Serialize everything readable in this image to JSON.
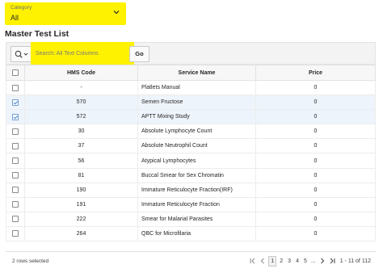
{
  "category": {
    "label": "Category",
    "value": "All"
  },
  "title": "Master Test List",
  "search": {
    "placeholder": "Search: All Text Columns",
    "go_label": "Go"
  },
  "table": {
    "columns": [
      "HMS Code",
      "Service Name",
      "Price"
    ],
    "rows": [
      {
        "hms": "-",
        "service": "Platlets Manual",
        "price": "0",
        "selected": false
      },
      {
        "hms": "570",
        "service": "Semen Fructose",
        "price": "0",
        "selected": true
      },
      {
        "hms": "572",
        "service": "APTT Mixing Study",
        "price": "0",
        "selected": true
      },
      {
        "hms": "30",
        "service": "Absolute Lymphocyte Count",
        "price": "0",
        "selected": false
      },
      {
        "hms": "37",
        "service": "Absolute Neutrophil Count",
        "price": "0",
        "selected": false
      },
      {
        "hms": "56",
        "service": "Atypical Lymphocytes",
        "price": "0",
        "selected": false
      },
      {
        "hms": "81",
        "service": "Buccal Smear for Sex Chromatin",
        "price": "0",
        "selected": false
      },
      {
        "hms": "190",
        "service": "Immature Reticulocyte Fraction(IRF)",
        "price": "0",
        "selected": false
      },
      {
        "hms": "191",
        "service": "Immature Reticulocyte Fraction",
        "price": "0",
        "selected": false
      },
      {
        "hms": "222",
        "service": "Smear for Malarial Parasites",
        "price": "0",
        "selected": false
      },
      {
        "hms": "264",
        "service": "QBC for Microfilaria",
        "price": "0",
        "selected": false
      }
    ]
  },
  "footer": {
    "rows_selected": "2 rows selected",
    "pages": [
      "1",
      "2",
      "3",
      "4",
      "5"
    ],
    "current_page": "1",
    "ellipsis": "...",
    "range": "1 - 11 of 112"
  }
}
